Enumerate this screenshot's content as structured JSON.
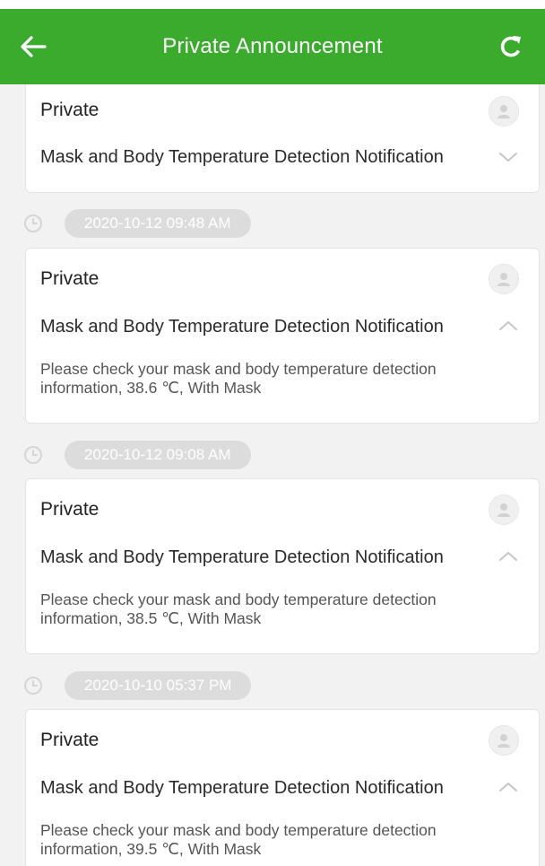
{
  "header": {
    "title": "Private Announcement",
    "back_icon": "arrow-left-icon",
    "refresh_icon": "refresh-icon",
    "background": "#3aab2d"
  },
  "announcements": [
    {
      "time": "",
      "category": "Private",
      "subject": "Mask and Body Temperature Detection Notification",
      "expanded": false,
      "body": ""
    },
    {
      "time": "2020-10-12 09:48 AM",
      "category": "Private",
      "subject": "Mask and Body Temperature Detection Notification",
      "expanded": true,
      "body": "Please check your mask and body temperature detection information, 38.6 ℃, With Mask"
    },
    {
      "time": "2020-10-12 09:08 AM",
      "category": "Private",
      "subject": "Mask and Body Temperature Detection Notification",
      "expanded": true,
      "body": "Please check your mask and body temperature detection information, 38.5 ℃, With Mask"
    },
    {
      "time": "2020-10-10 05:37 PM",
      "category": "Private",
      "subject": "Mask and Body Temperature Detection Notification",
      "expanded": true,
      "body": "Please check your mask and body temperature detection information, 39.5 ℃, With Mask"
    }
  ]
}
